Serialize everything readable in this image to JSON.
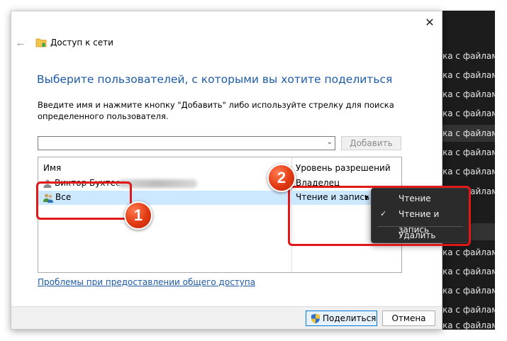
{
  "background_app": {
    "rows": [
      {
        "text": ""
      },
      {
        "text": ""
      },
      {
        "text": "ка с файлами"
      },
      {
        "text": "ка с файлами"
      },
      {
        "text": "ка с файлами"
      },
      {
        "text": "ка с файлами"
      },
      {
        "text": "ка с файлами"
      },
      {
        "text": "ка с файлами"
      },
      {
        "text": "ка с файлами"
      },
      {
        "text": "ка с файлами"
      },
      {
        "text": ""
      },
      {
        "text": ""
      },
      {
        "text": ""
      },
      {
        "text": "ка с файлами"
      },
      {
        "text": "ка с файлами"
      },
      {
        "text": "ка с файлами"
      },
      {
        "text": "ка с файлами"
      },
      {
        "text": "ка с файлами"
      }
    ]
  },
  "dialog": {
    "title": "Доступ к сети",
    "close_label": "✕",
    "back_label": "←",
    "heading": "Выберите пользователей, с которыми вы хотите поделиться",
    "description": "Введите имя и нажмите кнопку \"Добавить\" либо используйте стрелку для поиска определенного пользователя.",
    "name_input": {
      "value": "",
      "placeholder": ""
    },
    "add_button": "Добавить",
    "table": {
      "columns": [
        "Имя",
        "Уровень разрешений"
      ],
      "rows": [
        {
          "name": "Виктор Бухтеев",
          "permission": "Владелец"
        },
        {
          "name": "Все",
          "permission": "Чтение и запись"
        }
      ]
    },
    "help_link": "Проблемы при предоставлении общего доступа",
    "share_button": "Поделиться",
    "cancel_button": "Отмена"
  },
  "permission_menu": {
    "items": [
      {
        "label": "Чтение",
        "checked": false
      },
      {
        "label": "Чтение и запись",
        "checked": true
      },
      {
        "label": "Удалить",
        "checked": false
      }
    ]
  },
  "annotations": {
    "badge_1": "1",
    "badge_2": "2",
    "color": "#e01818"
  }
}
